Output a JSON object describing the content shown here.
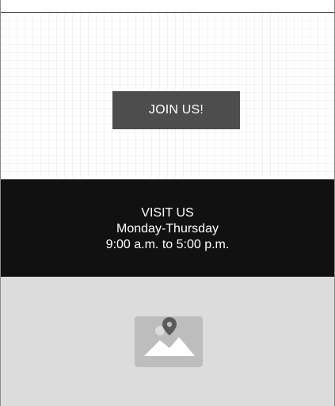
{
  "cta": {
    "button_label": "JOIN US!"
  },
  "visit": {
    "heading": "VISIT US",
    "days": "Monday-Thursday",
    "hours": "9:00 a.m. to 5:00 p.m."
  },
  "map": {
    "icon": "image-placeholder-icon",
    "pin_icon": "map-pin-icon"
  },
  "colors": {
    "button_bg": "#4d4d4d",
    "visit_bg": "#111111",
    "map_bg": "#dcdcdc",
    "placeholder_icon": "#bdbdbd",
    "pin": "#5a5a5a"
  }
}
